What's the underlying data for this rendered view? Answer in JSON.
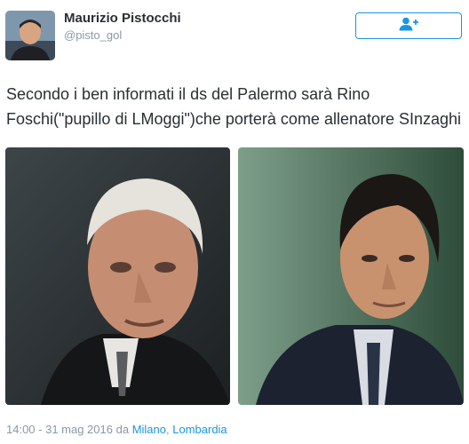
{
  "user": {
    "display_name": "Maurizio Pistocchi",
    "handle": "@pisto_gol"
  },
  "follow_button": {
    "icon": "add-user-icon"
  },
  "tweet": {
    "text": "Secondo i ben informati il ds del Palermo sarà Rino Foschi(\"pupillo di LMoggi\")che porterà come allenatore SInzaghi"
  },
  "media": [
    {
      "kind": "photo",
      "subject": "older man with white hair"
    },
    {
      "kind": "photo",
      "subject": "younger man in suit"
    }
  ],
  "meta": {
    "timestamp": "14:00 - 31 mag 2016",
    "da": "da",
    "city": "Milano",
    "separator": ", ",
    "region": "Lombardia"
  },
  "colors": {
    "accent": "#1b95e0",
    "muted": "#8899a6",
    "text": "#292f33"
  }
}
